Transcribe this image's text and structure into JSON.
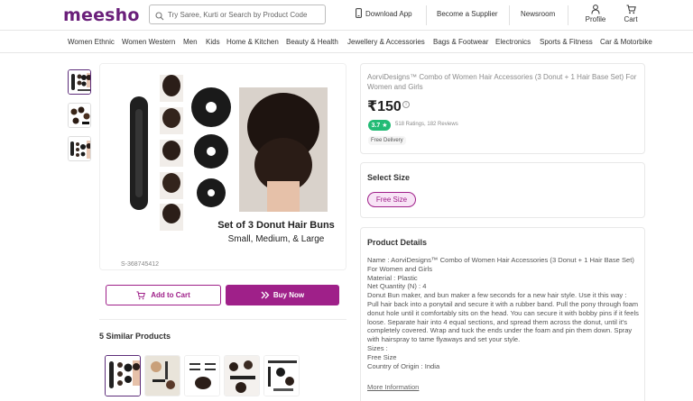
{
  "brand": {
    "logo": "meesho"
  },
  "search": {
    "placeholder": "Try Saree, Kurti or Search by Product Code"
  },
  "header": {
    "download_app": "Download App",
    "become_supplier": "Become a Supplier",
    "newsroom": "Newsroom",
    "profile": "Profile",
    "cart": "Cart"
  },
  "categories": [
    "Women Ethnic",
    "Women Western",
    "Men",
    "Kids",
    "Home & Kitchen",
    "Beauty & Health",
    "Jewellery & Accessories",
    "Bags & Footwear",
    "Electronics",
    "Sports & Fitness",
    "Car & Motorbike"
  ],
  "gallery": {
    "image_code": "S-368745412",
    "caption_line1": "Set of 3 Donut Hair Buns",
    "caption_line2": "Small, Medium, & Large"
  },
  "actions": {
    "add_to_cart": "Add to Cart",
    "buy_now": "Buy Now"
  },
  "similar": {
    "title": "5 Similar Products"
  },
  "product": {
    "title": "AorviDesigns™ Combo of Women Hair Accessories (3 Donut + 1 Hair Base Set) For Women and Girls",
    "price": "₹150",
    "rating": "3.7 ★",
    "ratings_reviews": "518 Ratings, 182 Reviews",
    "free_delivery": "Free Delivery"
  },
  "select_size": {
    "title": "Select Size",
    "option": "Free Size"
  },
  "details": {
    "title": "Product Details",
    "name": "Name : AorviDesigns™ Combo of Women Hair Accessories (3 Donut + 1 Hair Base Set) For Women and Girls",
    "material": "Material : Plastic",
    "net_quantity": "Net Quantity (N) : 4",
    "description": "Donut Bun maker, and bun maker a few seconds for a new hair style. Use it this way : Pull hair back into a ponytail and secure it with a rubber band. Pull the pony through foam donut hole until it comfortably sits on the head. You can secure it with bobby pins if it feels loose. Separate hair into 4 equal sections, and spread them across the donut, until it's completely covered. Wrap and tuck the ends under the foam and pin them down. Spray with hairspray to tame flyaways and set your style.",
    "sizes_label": "Sizes :",
    "sizes_value": "Free Size",
    "country": "Country of Origin : India",
    "more": "More Information"
  },
  "colors": {
    "brand": "#9f2089",
    "logo": "#6a1f7a",
    "rating": "#23bb75"
  }
}
